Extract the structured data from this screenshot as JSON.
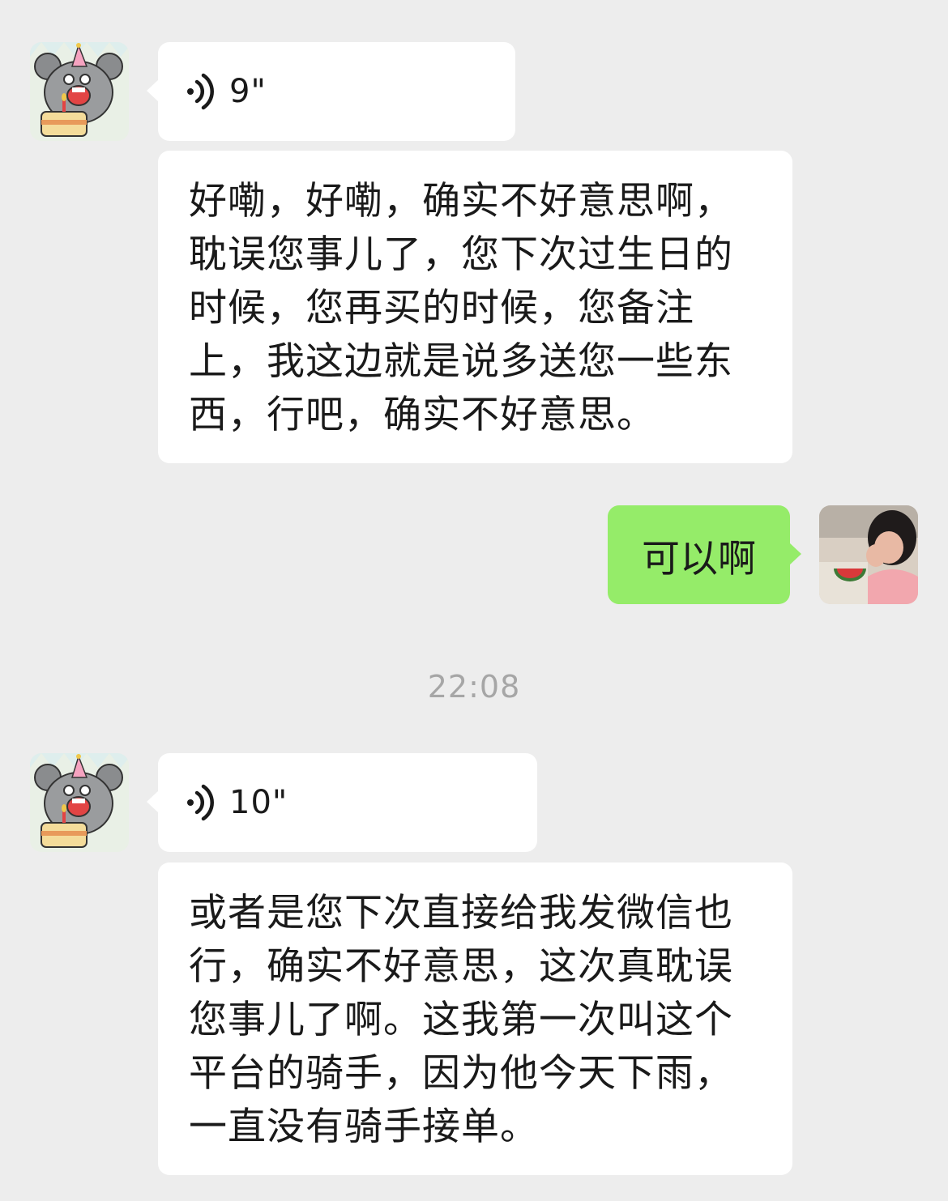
{
  "conversation": {
    "messages": [
      {
        "sender": "contact",
        "type": "voice",
        "duration": "9\""
      },
      {
        "sender": "contact",
        "type": "text",
        "text": "好嘞，好嘞，确实不好意思啊，耽误您事儿了，您下次过生日的时候，您再买的时候，您备注上，我这边就是说多送您一些东西，行吧，确实不好意思。"
      },
      {
        "sender": "me",
        "type": "text",
        "text": "可以啊"
      },
      {
        "sender": "contact",
        "type": "voice",
        "duration": "10\""
      },
      {
        "sender": "contact",
        "type": "text",
        "text": "或者是您下次直接给我发微信也行，确实不好意思，这次真耽误您事儿了啊。这我第一次叫这个平台的骑手，因为他今天下雨，一直没有骑手接单。"
      }
    ],
    "timestamp": "22:08"
  },
  "avatars": {
    "contact": "birthday-mouse-avatar",
    "me": "user-photo-avatar"
  },
  "colors": {
    "background": "#ededed",
    "received_bubble": "#ffffff",
    "sent_bubble": "#95ec69",
    "timestamp": "#a6a6a6"
  }
}
